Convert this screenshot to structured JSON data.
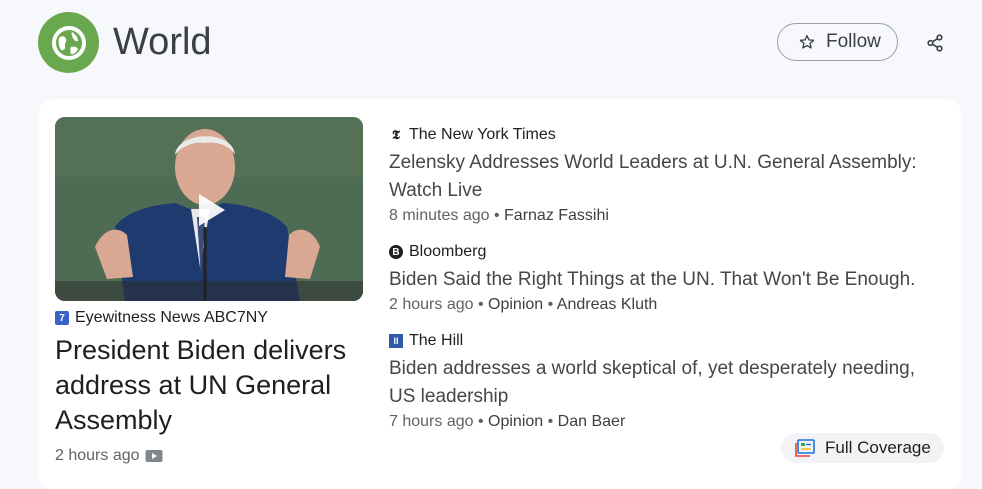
{
  "header": {
    "title": "World",
    "follow_label": "Follow",
    "icon": "globe-icon",
    "icon_color": "#6aa84f"
  },
  "lead": {
    "source": "Eyewitness News ABC7NY",
    "title": "President Biden delivers address at UN General Assembly",
    "time": "2 hours ago",
    "media": "video"
  },
  "stories": [
    {
      "source": "The New York Times",
      "title": "Zelensky Addresses World Leaders at U.N. General Assembly: Watch Live",
      "time": "8 minutes ago",
      "meta": "Farnaz Fassihi"
    },
    {
      "source": "Bloomberg",
      "title": "Biden Said the Right Things at the UN. That Won't Be Enough.",
      "time": "2 hours ago",
      "meta": "Opinion",
      "author": "Andreas Kluth"
    },
    {
      "source": "The Hill",
      "title": "Biden addresses a world skeptical of, yet desperately needing, US leadership",
      "time": "7 hours ago",
      "meta": "Opinion",
      "author": "Dan Baer"
    }
  ],
  "full_coverage_label": "Full Coverage"
}
